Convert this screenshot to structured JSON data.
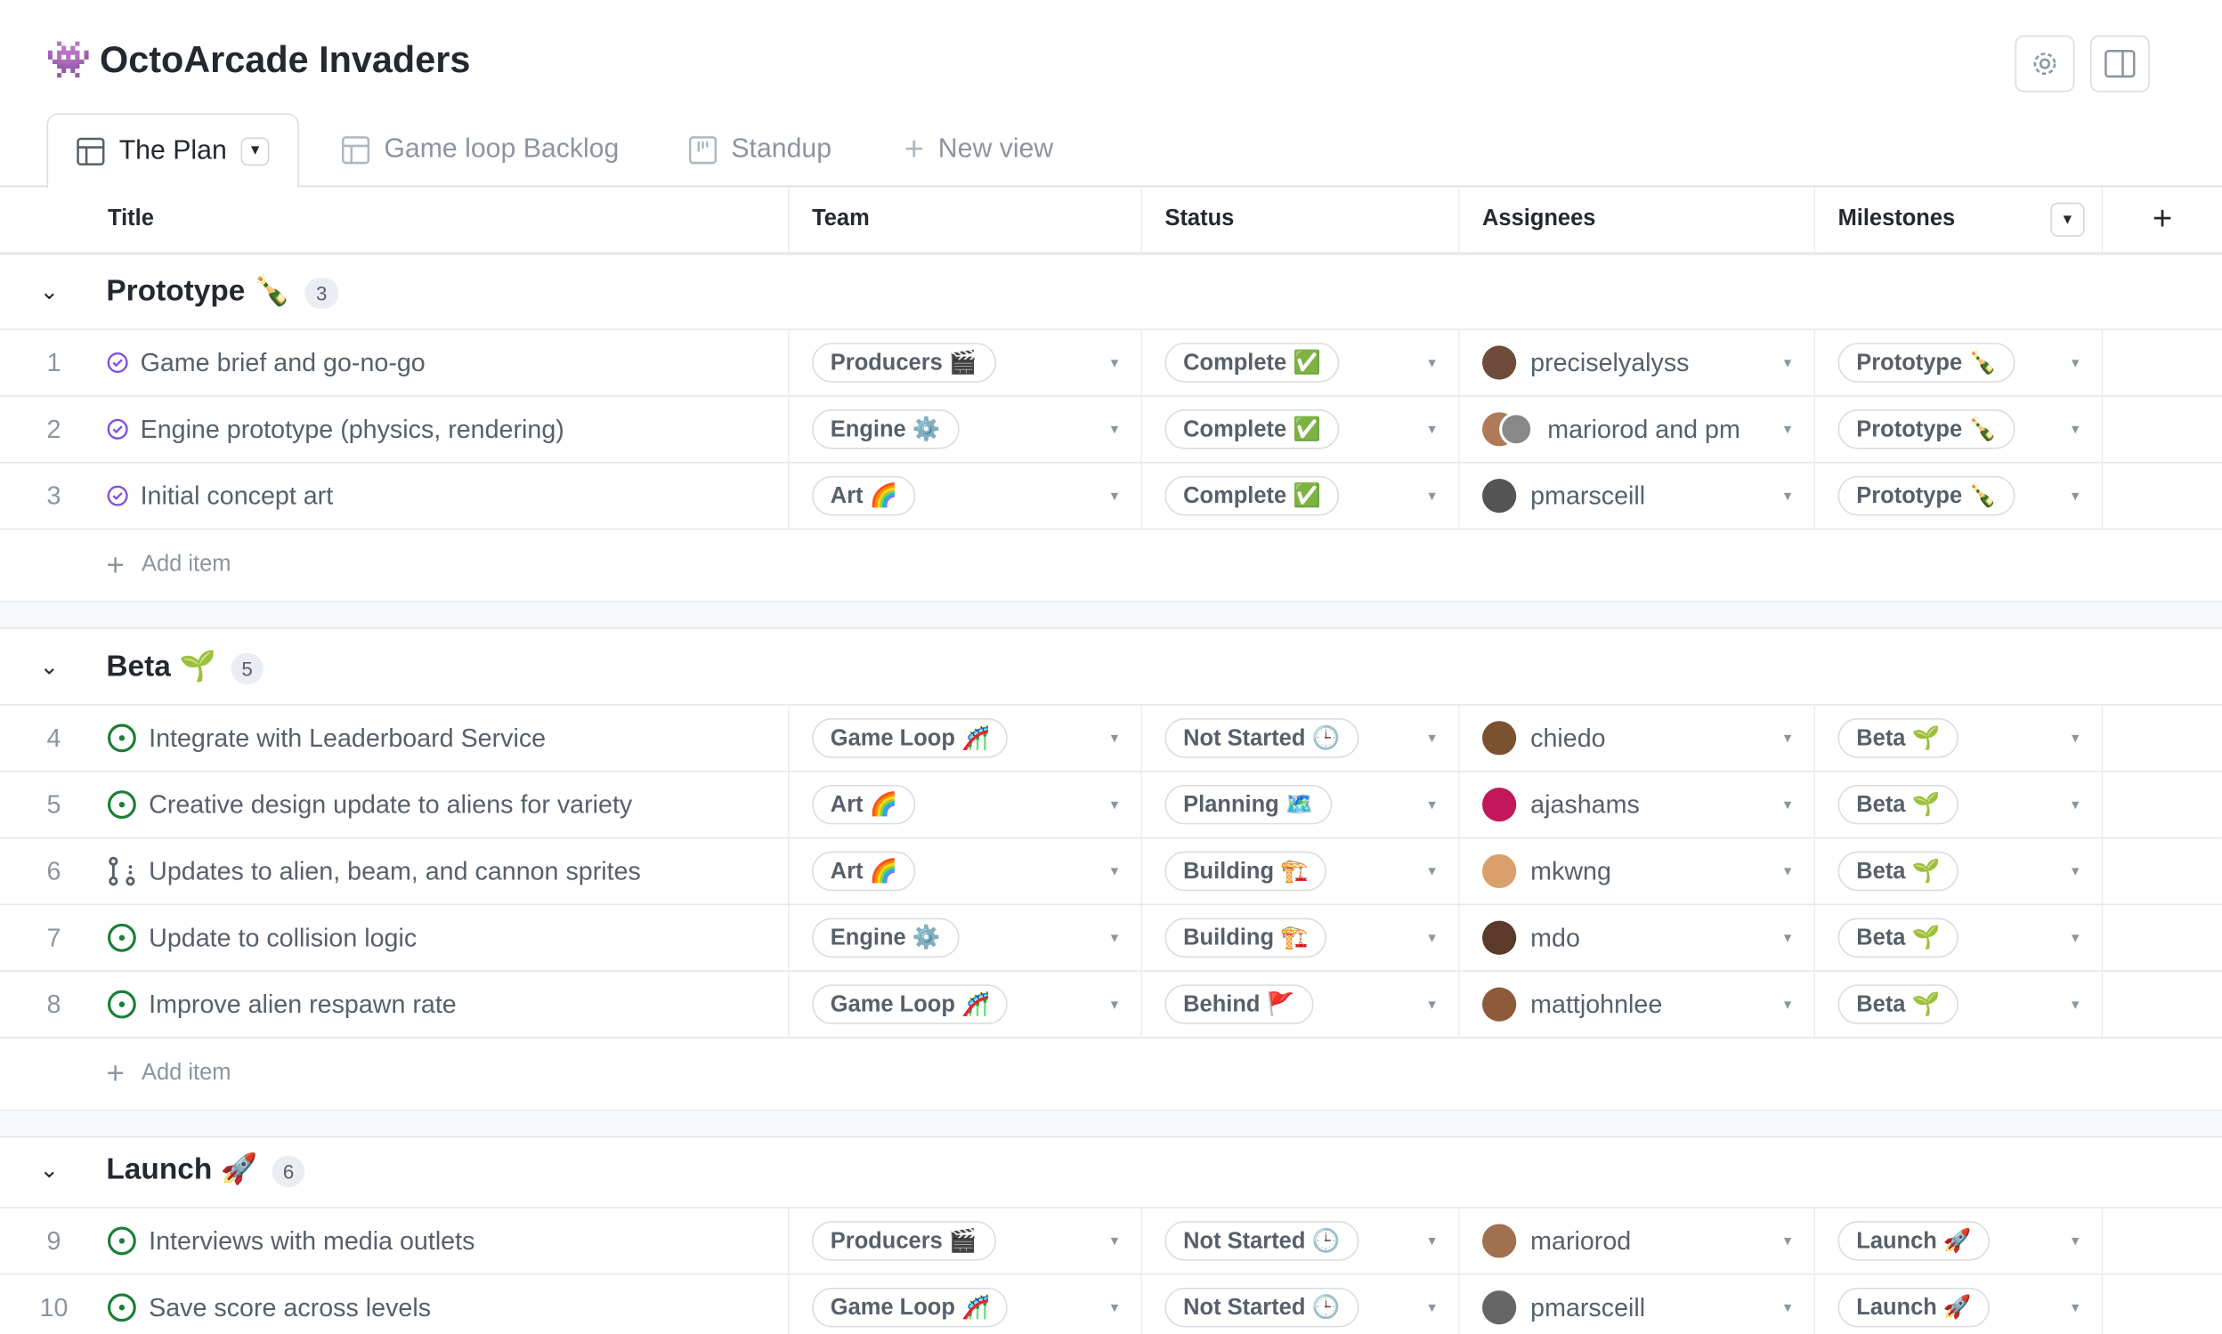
{
  "project": {
    "title": "OctoArcade Invaders",
    "icon": "👾"
  },
  "toolbar": {
    "settings_icon": "gear-icon",
    "panel_icon": "sidebar-panel-icon"
  },
  "tabs": [
    {
      "label": "The Plan",
      "icon": "table-icon",
      "active": true
    },
    {
      "label": "Game loop Backlog",
      "icon": "table-icon"
    },
    {
      "label": "Standup",
      "icon": "board-icon"
    },
    {
      "label": "New view",
      "icon": "plus-icon"
    }
  ],
  "columns": [
    "Title",
    "Team",
    "Status",
    "Assignees",
    "Milestones"
  ],
  "add_item_label": "Add item",
  "colors": {
    "done": "#8250df",
    "open": "#1a7f37",
    "border": "#d8dee4",
    "group_gap": "#f6f8fa"
  },
  "groups": [
    {
      "name": "Prototype 🍾",
      "count": "3",
      "items": [
        {
          "n": "1",
          "title": "Game brief and go-no-go",
          "state": "done",
          "team": "Producers 🎬",
          "status": "Complete ✅",
          "assignee": "preciselyalyss",
          "milestone": "Prototype 🍾"
        },
        {
          "n": "2",
          "title": "Engine prototype (physics, rendering)",
          "state": "done",
          "team": "Engine ⚙️",
          "status": "Complete ✅",
          "assignee": "mariorod and pm",
          "multi": true,
          "milestone": "Prototype 🍾"
        },
        {
          "n": "3",
          "title": "Initial concept art",
          "state": "done",
          "team": "Art 🌈",
          "status": "Complete ✅",
          "assignee": "pmarsceill",
          "milestone": "Prototype 🍾"
        }
      ]
    },
    {
      "name": "Beta 🌱",
      "count": "5",
      "items": [
        {
          "n": "4",
          "title": "Integrate with Leaderboard Service",
          "state": "open",
          "team": "Game Loop 🎢",
          "status": "Not Started 🕒",
          "assignee": "chiedo",
          "milestone": "Beta 🌱"
        },
        {
          "n": "5",
          "title": "Creative design update to aliens for variety",
          "state": "open",
          "team": "Art 🌈",
          "status": "Planning 🗺️",
          "assignee": "ajashams",
          "milestone": "Beta 🌱"
        },
        {
          "n": "6",
          "title": "Updates to alien, beam, and cannon sprites",
          "state": "draft-pr",
          "team": "Art 🌈",
          "status": "Building 🏗️",
          "assignee": "mkwng",
          "milestone": "Beta 🌱"
        },
        {
          "n": "7",
          "title": "Update to collision logic",
          "state": "open",
          "team": "Engine ⚙️",
          "status": "Building 🏗️",
          "assignee": "mdo",
          "milestone": "Beta 🌱"
        },
        {
          "n": "8",
          "title": "Improve alien respawn rate",
          "state": "open",
          "team": "Game Loop 🎢",
          "status": "Behind 🚩",
          "assignee": "mattjohnlee",
          "milestone": "Beta 🌱"
        }
      ]
    },
    {
      "name": "Launch 🚀",
      "count": "6",
      "items": [
        {
          "n": "9",
          "title": "Interviews with media outlets",
          "state": "open",
          "team": "Producers 🎬",
          "status": "Not Started 🕒",
          "assignee": "mariorod",
          "milestone": "Launch 🚀"
        },
        {
          "n": "10",
          "title": "Save score across levels",
          "state": "open",
          "team": "Game Loop 🎢",
          "status": "Not Started 🕒",
          "assignee": "pmarsceill",
          "milestone": "Launch 🚀"
        }
      ]
    }
  ]
}
